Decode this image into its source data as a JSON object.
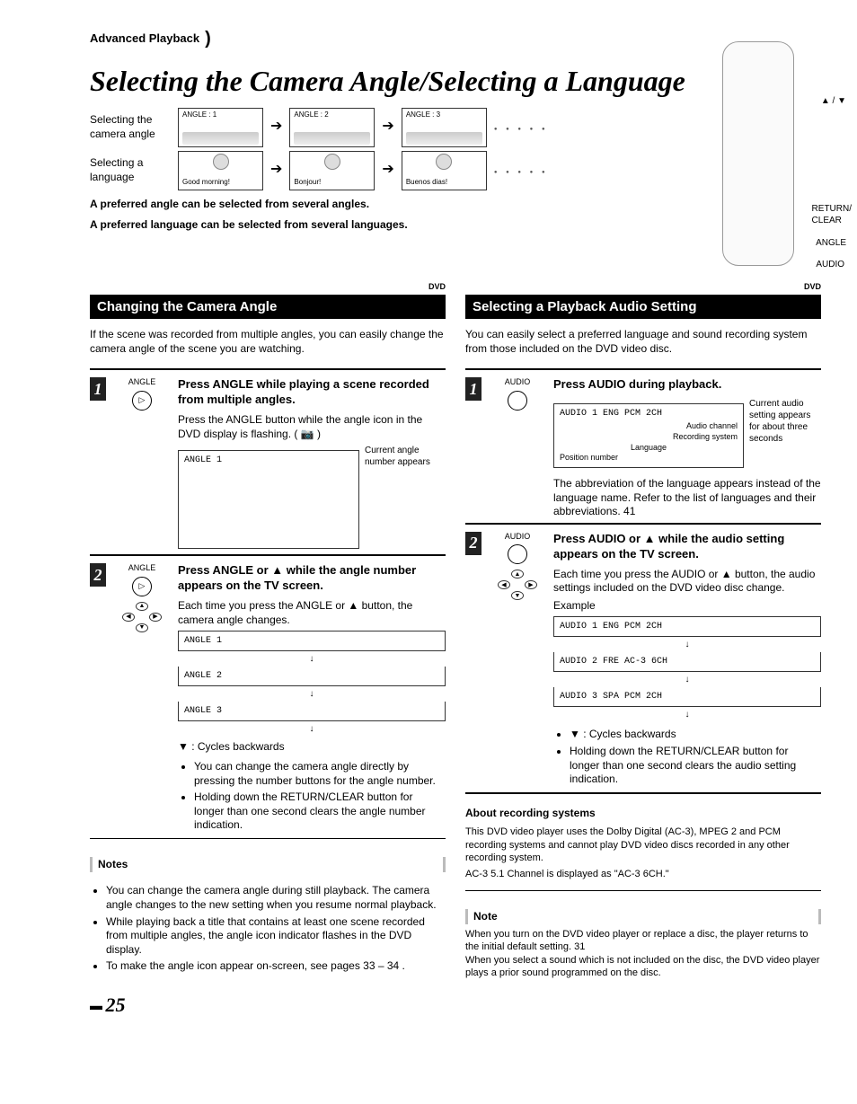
{
  "breadcrumb": "Advanced Playback",
  "title": "Selecting the Camera Angle/Selecting a Language",
  "intro": {
    "angle_label": "Selecting the camera angle",
    "lang_label": "Selecting a language",
    "angle_thumbs": [
      "ANGLE : 1",
      "ANGLE : 2",
      "ANGLE : 3"
    ],
    "lang_thumbs": [
      "Good morning!",
      "Bonjour!",
      "Buenos dias!"
    ],
    "preferred1": "A preferred angle can be selected from several angles.",
    "preferred2": "A preferred language can be selected from several languages."
  },
  "remote_labels": {
    "updown": "▲ / ▼",
    "return": "RETURN/\nCLEAR",
    "angle": "ANGLE",
    "audio": "AUDIO"
  },
  "dvd_tag": "DVD",
  "left": {
    "bar": "Changing the Camera Angle",
    "lead": "If the scene was recorded from multiple angles, you can easily change the camera angle of the scene you are watching.",
    "step1": {
      "btn": "ANGLE",
      "head": "Press ANGLE while playing a scene recorded from multiple angles.",
      "body": "Press the ANGLE button while the angle icon in the DVD display is flashing. ( 📷 )",
      "osd": "ANGLE  1",
      "osd_note": "Current angle number appears"
    },
    "step2": {
      "btn": "ANGLE",
      "head": "Press ANGLE or ▲ while the angle number appears on the TV screen.",
      "body": "Each time you press the ANGLE or ▲ button, the camera angle changes.",
      "osd": [
        "ANGLE  1",
        "ANGLE  2",
        "ANGLE  3"
      ],
      "cycles": "▼ : Cycles backwards",
      "bullets": [
        "You can change the camera angle directly by pressing the number buttons for the angle number.",
        "Holding down the RETURN/CLEAR button for longer than one second clears the angle number indication."
      ]
    },
    "notes_head": "Notes",
    "notes": [
      "You can change the camera angle during still playback. The camera angle changes to the new setting when you resume normal playback.",
      "While playing back a title that contains at least one scene recorded from multiple angles, the angle icon indicator flashes in the DVD display.",
      "To make the angle icon appear on-screen, see pages 33 – 34 ."
    ]
  },
  "right": {
    "bar": "Selecting a Playback Audio Setting",
    "lead": "You can easily select a preferred language and sound recording system from those included on the DVD video disc.",
    "step1": {
      "btn": "AUDIO",
      "head": "Press AUDIO during playback.",
      "osd_line": "AUDIO  1  ENG  PCM   2CH",
      "labels": {
        "pos": "Position number",
        "lang": "Language",
        "rec": "Recording system",
        "chan": "Audio channel",
        "side": "Current audio setting appears for about three seconds"
      },
      "abbrev": "The abbreviation of the language appears instead of the language name. Refer to the list of languages and their abbreviations. 41"
    },
    "step2": {
      "btn": "AUDIO",
      "head": "Press AUDIO or ▲ while the audio setting appears on the TV screen.",
      "body": "Each time you press the AUDIO or ▲ button, the audio settings included on the DVD video disc change.",
      "example_label": "Example",
      "osd": [
        "AUDIO  1  ENG  PCM   2CH",
        "AUDIO  2  FRE  AC-3  6CH",
        "AUDIO  3  SPA  PCM   2CH"
      ],
      "cycles": "▼ : Cycles backwards",
      "bullets": [
        "Holding down the RETURN/CLEAR button for longer than one second clears the audio setting indication."
      ]
    },
    "about_head": "About recording systems",
    "about_body": "This DVD video player uses the Dolby Digital (AC-3), MPEG 2 and PCM recording systems and cannot play DVD video discs recorded in any other recording system.",
    "about_body2": "AC-3 5.1 Channel is displayed as \"AC-3 6CH.\"",
    "note_head": "Note",
    "note1": "When you turn on the DVD video player or replace a disc, the player returns to the initial default setting. 31",
    "note2": "When you select a sound which is not included on the disc, the DVD video player plays a prior sound programmed on the disc."
  },
  "page_number": "25"
}
